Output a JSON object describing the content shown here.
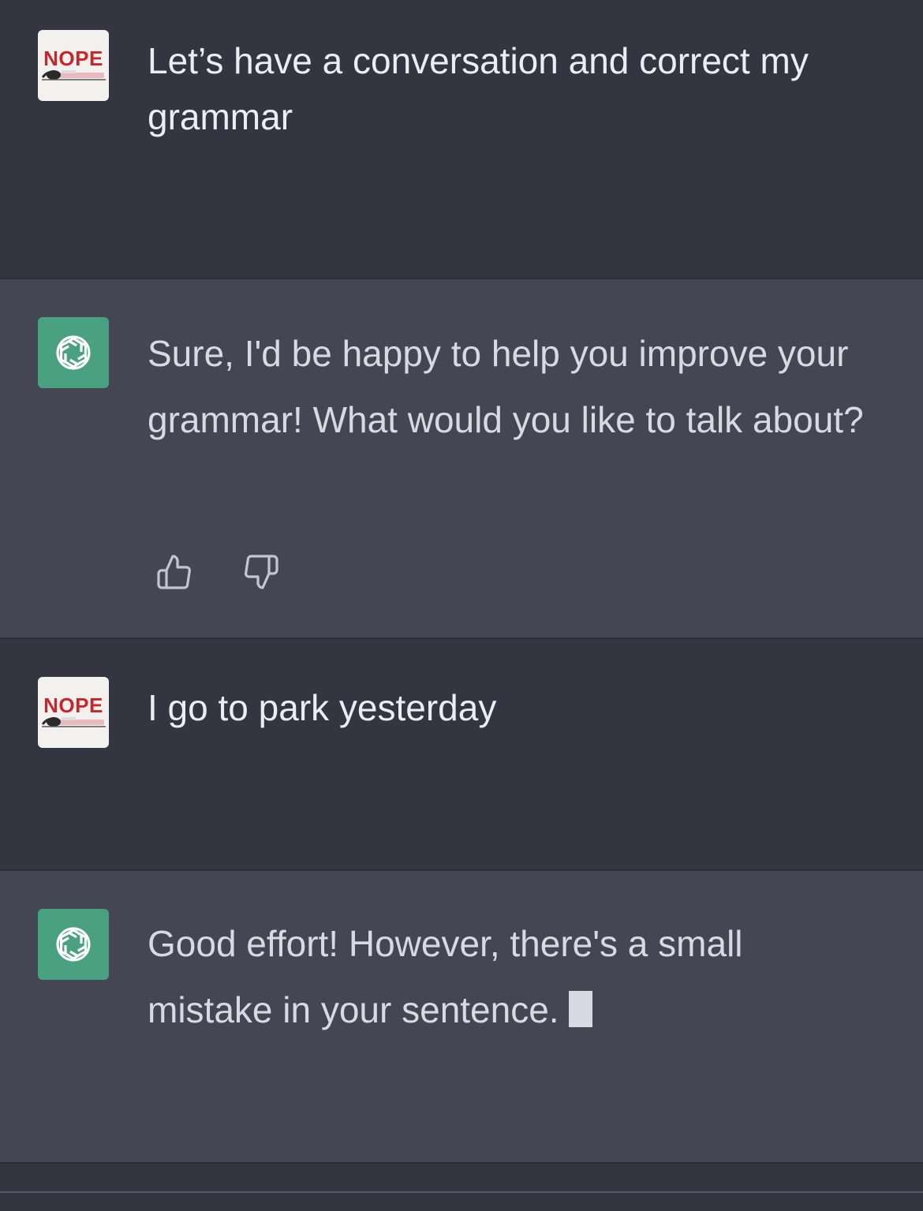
{
  "conversation": {
    "messages": [
      {
        "role": "user",
        "avatar_text": "NOPE",
        "text": "Let’s have a conversation and correct my grammar"
      },
      {
        "role": "assistant",
        "avatar_icon": "chatgpt-logo-icon",
        "text": "Sure, I'd be happy to help you improve your grammar! What would you like to talk about?",
        "feedback": {
          "thumbs_up_icon": "thumbs-up-icon",
          "thumbs_down_icon": "thumbs-down-icon"
        }
      },
      {
        "role": "user",
        "avatar_text": "NOPE",
        "text": "I go to park yesterday"
      },
      {
        "role": "assistant",
        "avatar_icon": "chatgpt-logo-icon",
        "text": "Good effort! However, there's a small mistake in your sentence.",
        "streaming": true
      }
    ]
  },
  "colors": {
    "user_bg": "#343541",
    "assistant_bg": "#444654",
    "assistant_avatar": "#4aa181",
    "nope_red": "#c8262b",
    "text": "#ececf1"
  }
}
